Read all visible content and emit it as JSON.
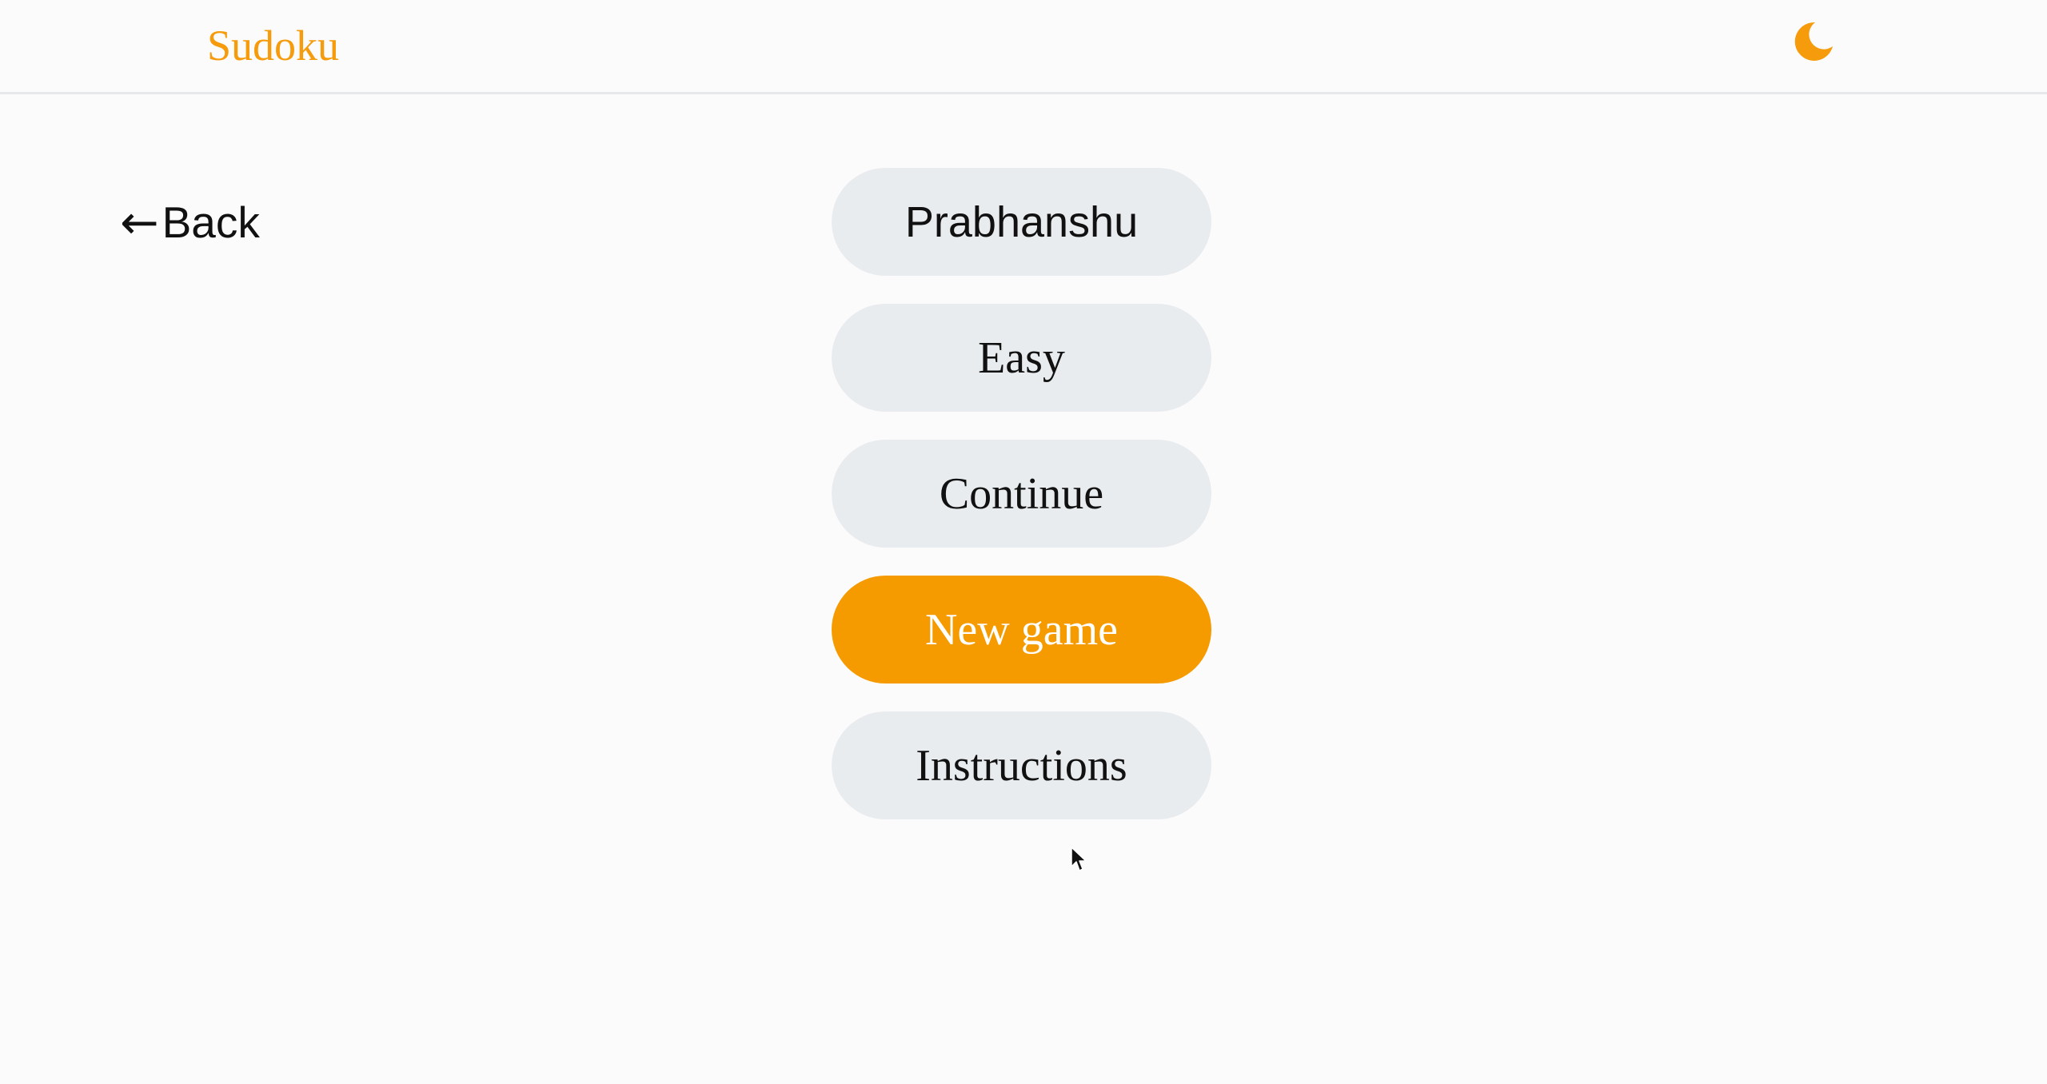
{
  "header": {
    "app_title": "Sudoku",
    "theme_toggle_icon": "moon-icon",
    "accent_color": "#f59b00"
  },
  "back": {
    "arrow": "←",
    "label": "Back"
  },
  "menu": {
    "player_name": "Prabhanshu",
    "difficulty": "Easy",
    "continue_label": "Continue",
    "new_game_label": "New game",
    "instructions_label": "Instructions"
  }
}
